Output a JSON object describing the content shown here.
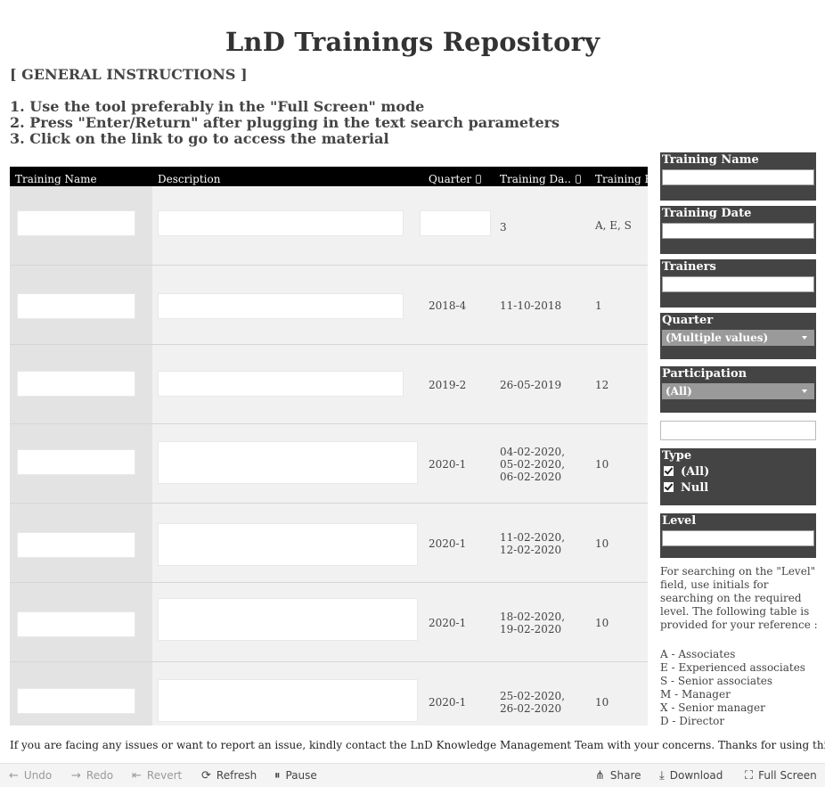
{
  "title": "LnD Trainings Repository",
  "instructions": {
    "heading": "[ GENERAL INSTRUCTIONS ]",
    "lines": [
      "1. Use the tool preferably in the \"Full Screen\" mode",
      "2. Press \"Enter/Return\" after plugging in the text search parameters",
      "3. Click on the link to go to access the material"
    ]
  },
  "table": {
    "headers": [
      "Training Name",
      "Description",
      "Quarter",
      "Training Da..",
      "Training H"
    ],
    "rows": [
      {
        "quarter": "",
        "date": "3",
        "hours": "A, E, S"
      },
      {
        "quarter": "2018-4",
        "date": "11-10-2018",
        "hours": "1"
      },
      {
        "quarter": "2019-2",
        "date": "26-05-2019",
        "hours": "12"
      },
      {
        "quarter": "2020-1",
        "date": "04-02-2020,\n05-02-2020,\n06-02-2020",
        "hours": "10"
      },
      {
        "quarter": "2020-1",
        "date": "11-02-2020,\n12-02-2020",
        "hours": "10"
      },
      {
        "quarter": "2020-1",
        "date": "18-02-2020,\n19-02-2020",
        "hours": "10"
      },
      {
        "quarter": "2020-1",
        "date": "25-02-2020,\n26-02-2020",
        "hours": "10"
      }
    ]
  },
  "filters": {
    "training_name": {
      "label": "Training Name",
      "value": ""
    },
    "training_date": {
      "label": "Training Date",
      "value": ""
    },
    "trainers": {
      "label": "Trainers",
      "value": ""
    },
    "quarter": {
      "label": "Quarter",
      "value": "(Multiple values)"
    },
    "participation": {
      "label": "Participation",
      "value": "(All)"
    },
    "type": {
      "label": "Type",
      "options": [
        "(All)",
        "Null"
      ]
    },
    "level": {
      "label": "Level",
      "value": ""
    }
  },
  "help": {
    "text": "For searching on the \"Level\" field, use initials for searching on the required level. The following table is provided for your reference :",
    "levels": [
      "A - Associates",
      "E - Experienced associates",
      "S - Senior associates",
      "M - Manager",
      "X - Senior manager",
      "D - Director"
    ]
  },
  "footer_note": "If you are facing any issues or want to report an issue, kindly contact the LnD Knowledge Management Team with your concerns. Thanks for using this tool !",
  "toolbar": {
    "undo": "Undo",
    "redo": "Redo",
    "revert": "Revert",
    "refresh": "Refresh",
    "pause": "Pause",
    "share": "Share",
    "download": "Download",
    "full_screen": "Full Screen"
  }
}
